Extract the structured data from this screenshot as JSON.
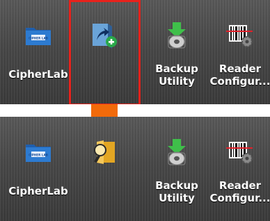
{
  "tiles": [
    {
      "label": "CipherLab",
      "icon": "cipherlab-folder-icon"
    },
    {
      "label": "",
      "icon": "shortcut-add-icon"
    },
    {
      "label": "Backup\nUtility",
      "icon": "backup-utility-icon"
    },
    {
      "label": "Reader\nConfigur...",
      "icon": "reader-config-icon"
    }
  ],
  "tiles_after": [
    {
      "label": "CipherLab",
      "icon": "cipherlab-folder-icon"
    },
    {
      "label": "",
      "icon": "folder-search-icon"
    },
    {
      "label": "Backup\nUtility",
      "icon": "backup-utility-icon"
    },
    {
      "label": "Reader\nConfigur...",
      "icon": "reader-config-icon"
    }
  ],
  "cipherlab_badge": "CIPHER LAB",
  "colors": {
    "highlight": "#e8221c",
    "arrow": "#f26a0a"
  }
}
